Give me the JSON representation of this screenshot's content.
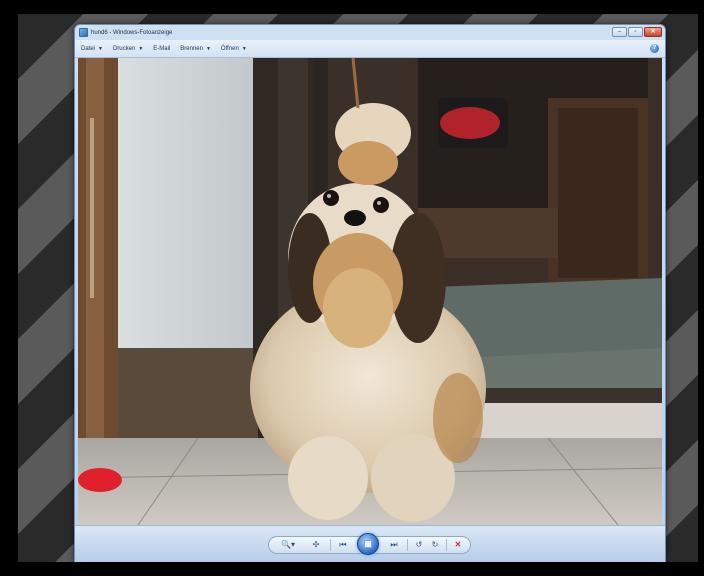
{
  "window": {
    "title": "hund6 - Windows-Fotoanzeige",
    "icon": "photo-viewer-icon",
    "caption_buttons": [
      "minimize",
      "maximize",
      "close"
    ]
  },
  "menu": {
    "items": [
      {
        "label": "Datei",
        "dropdown": true
      },
      {
        "label": "Drucken",
        "dropdown": true
      },
      {
        "label": "E-Mail",
        "dropdown": false
      },
      {
        "label": "Brennen",
        "dropdown": true
      },
      {
        "label": "Öffnen",
        "dropdown": true
      }
    ],
    "help_icon": "help-icon"
  },
  "photo": {
    "subject": "dog-photo"
  },
  "controls": {
    "buttons": [
      "zoom-icon",
      "actual-size-icon",
      "previous-icon",
      "slideshow-icon",
      "next-icon",
      "rotate-left-icon",
      "rotate-right-icon",
      "delete-icon"
    ],
    "accent": "#2a6bc4",
    "delete_color": "#d0312d"
  }
}
